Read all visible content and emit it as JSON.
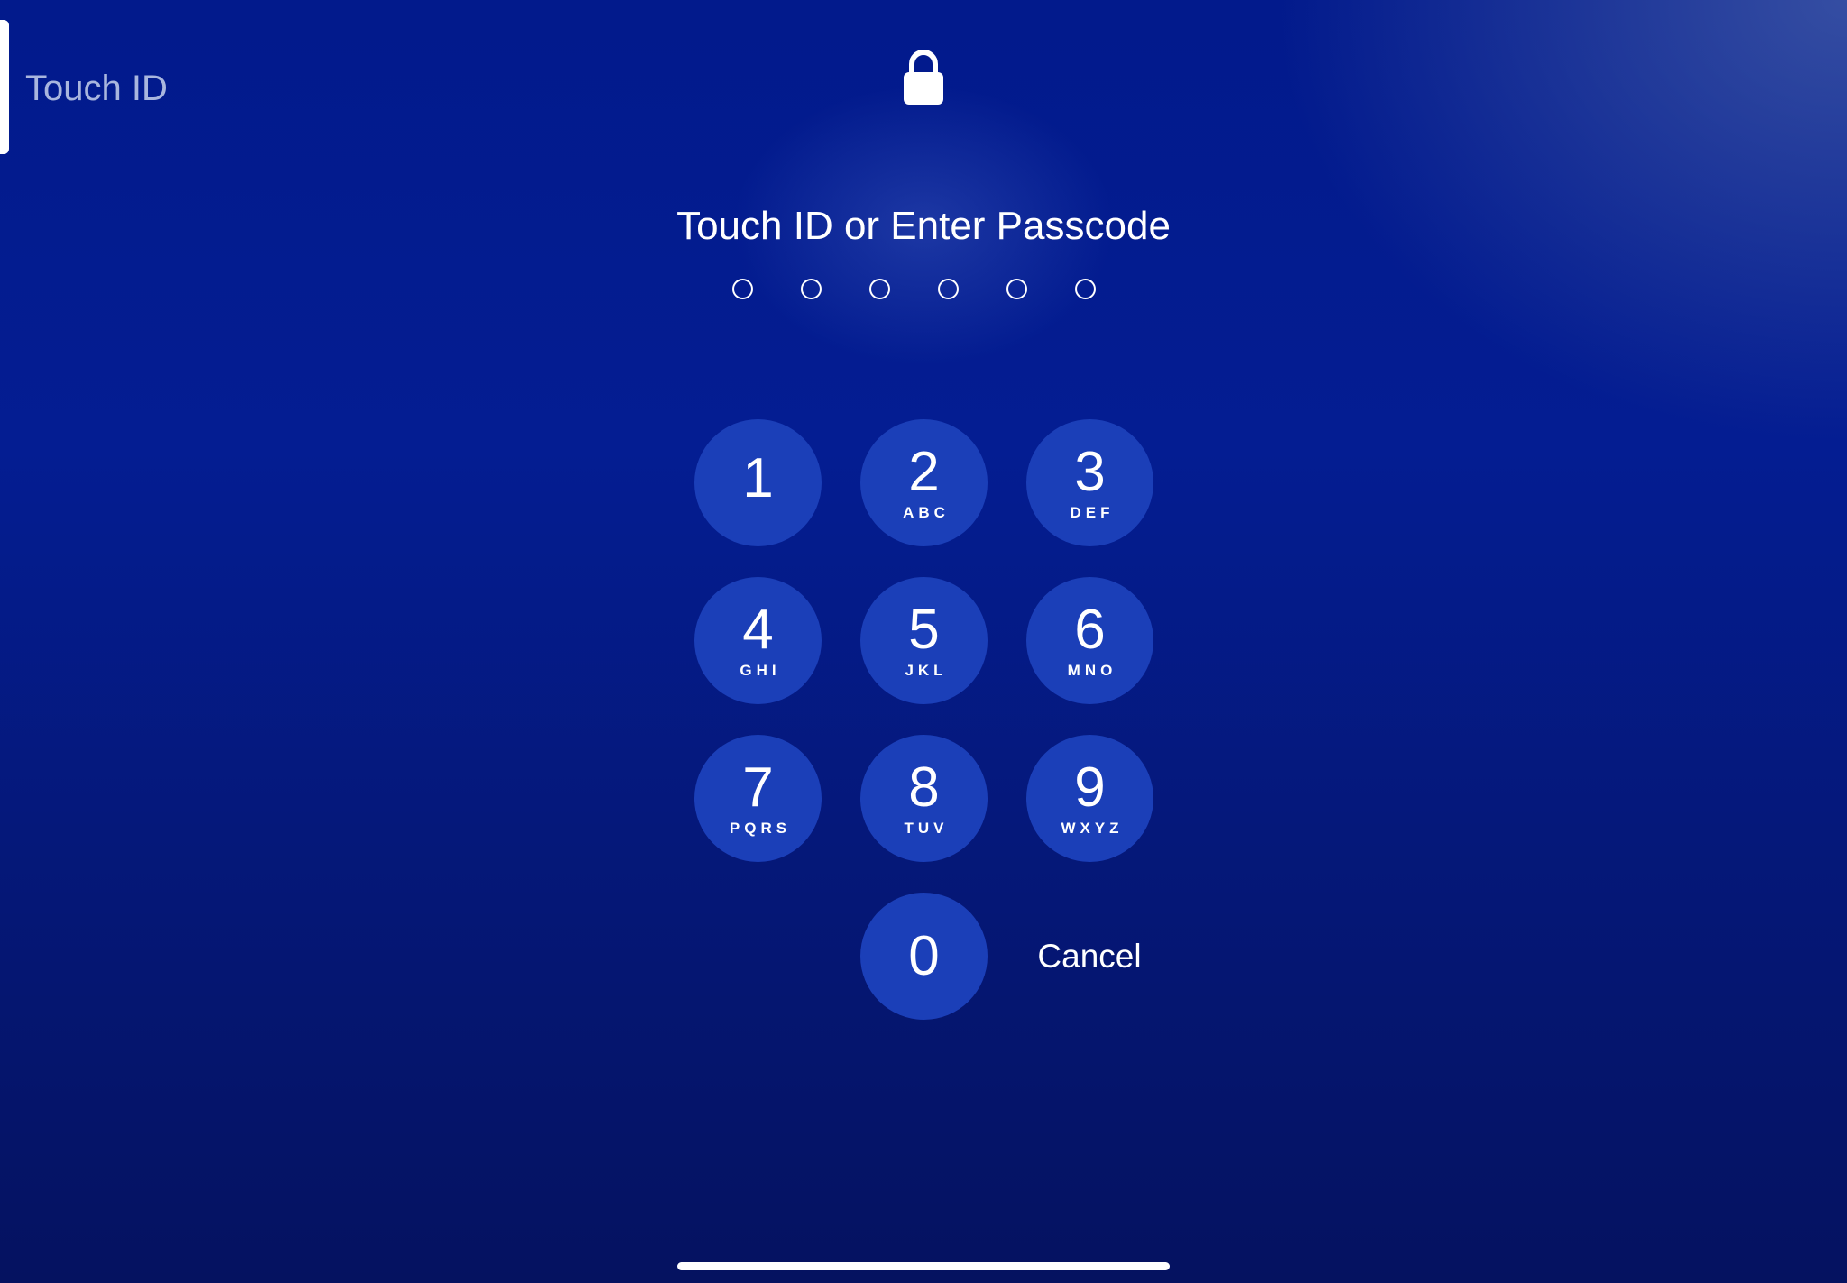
{
  "sidebar": {
    "label": "Touch ID"
  },
  "lock_screen": {
    "icon": "lock-icon",
    "prompt": "Touch ID or Enter Passcode",
    "passcode_length": 6,
    "entered_digits": 0
  },
  "keypad": {
    "keys": [
      {
        "digit": "1",
        "letters": ""
      },
      {
        "digit": "2",
        "letters": "ABC"
      },
      {
        "digit": "3",
        "letters": "DEF"
      },
      {
        "digit": "4",
        "letters": "GHI"
      },
      {
        "digit": "5",
        "letters": "JKL"
      },
      {
        "digit": "6",
        "letters": "MNO"
      },
      {
        "digit": "7",
        "letters": "PQRS"
      },
      {
        "digit": "8",
        "letters": "TUV"
      },
      {
        "digit": "9",
        "letters": "WXYZ"
      },
      {
        "digit": "0",
        "letters": ""
      }
    ],
    "cancel_label": "Cancel"
  },
  "colors": {
    "background_top": "#021a8c",
    "background_bottom": "#051260",
    "key_fill": "#1b3fb8",
    "text": "#ffffff",
    "corner_label": "#a9b6de"
  }
}
